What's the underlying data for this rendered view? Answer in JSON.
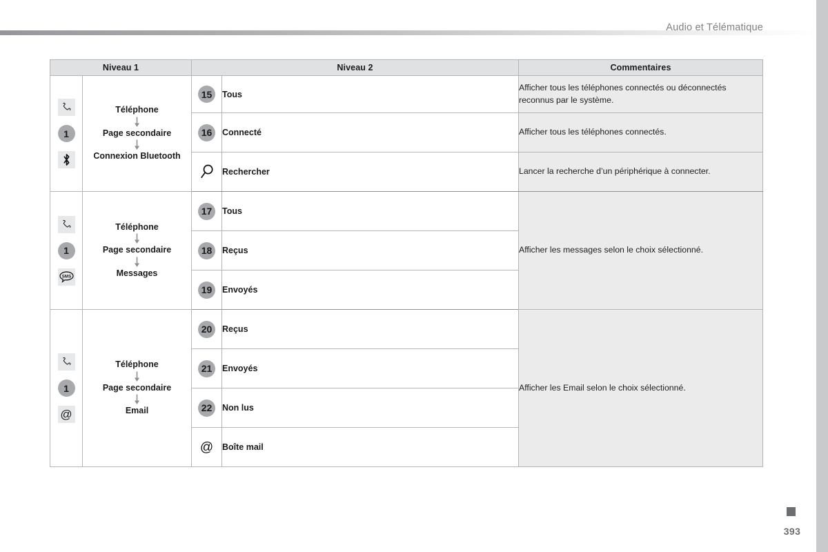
{
  "page": {
    "header_title": "Audio et Télématique",
    "page_number": "393",
    "accent_color": "#6d6e71",
    "circle_color": "#a7a9ac",
    "comment_bg": "#ebebec",
    "header_row_bg": "#e0e1e2"
  },
  "table": {
    "headers": {
      "level1": "Niveau 1",
      "level2": "Niveau 2",
      "comments": "Commentaires"
    },
    "blocks": [
      {
        "icons": [
          {
            "kind": "square",
            "name": "phone-handset-icon",
            "glyph": "phone"
          },
          {
            "kind": "circle",
            "name": "badge-1",
            "glyph": "1"
          },
          {
            "kind": "square",
            "name": "bluetooth-icon",
            "glyph": "bluetooth"
          }
        ],
        "path": [
          "Téléphone",
          "Page secondaire",
          "Connexion Bluetooth"
        ],
        "rows": [
          {
            "marker_kind": "circle",
            "marker": "15",
            "marker_name": "badge-15",
            "label": "Tous",
            "comment": "Afficher tous les téléphones connectés ou déconnectés reconnus par le système."
          },
          {
            "marker_kind": "circle",
            "marker": "16",
            "marker_name": "badge-16",
            "label": "Connecté",
            "comment": "Afficher tous les téléphones connectés."
          },
          {
            "marker_kind": "glyph",
            "marker": "search",
            "marker_name": "magnifier-icon",
            "label": "Rechercher",
            "comment": "Lancer la recherche d’un périphérique à connecter."
          }
        ],
        "merged_comment": null
      },
      {
        "icons": [
          {
            "kind": "square",
            "name": "phone-handset-icon",
            "glyph": "phone"
          },
          {
            "kind": "circle",
            "name": "badge-1",
            "glyph": "1"
          },
          {
            "kind": "square",
            "name": "sms-bubble-icon",
            "glyph": "sms"
          }
        ],
        "path": [
          "Téléphone",
          "Page secondaire",
          "Messages"
        ],
        "rows": [
          {
            "marker_kind": "circle",
            "marker": "17",
            "marker_name": "badge-17",
            "label": "Tous",
            "comment": null
          },
          {
            "marker_kind": "circle",
            "marker": "18",
            "marker_name": "badge-18",
            "label": "Reçus",
            "comment": null
          },
          {
            "marker_kind": "circle",
            "marker": "19",
            "marker_name": "badge-19",
            "label": "Envoyés",
            "comment": null
          }
        ],
        "merged_comment": "Afficher les messages selon le choix sélectionné."
      },
      {
        "icons": [
          {
            "kind": "square",
            "name": "phone-handset-icon",
            "glyph": "phone"
          },
          {
            "kind": "circle",
            "name": "badge-1",
            "glyph": "1"
          },
          {
            "kind": "square",
            "name": "at-sign-icon",
            "glyph": "@"
          }
        ],
        "path": [
          "Téléphone",
          "Page secondaire",
          "Email"
        ],
        "rows": [
          {
            "marker_kind": "circle",
            "marker": "20",
            "marker_name": "badge-20",
            "label": "Reçus",
            "comment": null
          },
          {
            "marker_kind": "circle",
            "marker": "21",
            "marker_name": "badge-21",
            "label": "Envoyés",
            "comment": null
          },
          {
            "marker_kind": "circle",
            "marker": "22",
            "marker_name": "badge-22",
            "label": "Non lus",
            "comment": null
          },
          {
            "marker_kind": "glyph",
            "marker": "@",
            "marker_name": "at-sign-icon",
            "label": "Boîte mail",
            "comment": null
          }
        ],
        "merged_comment": "Afficher les Email selon le choix sélectionné."
      }
    ]
  }
}
